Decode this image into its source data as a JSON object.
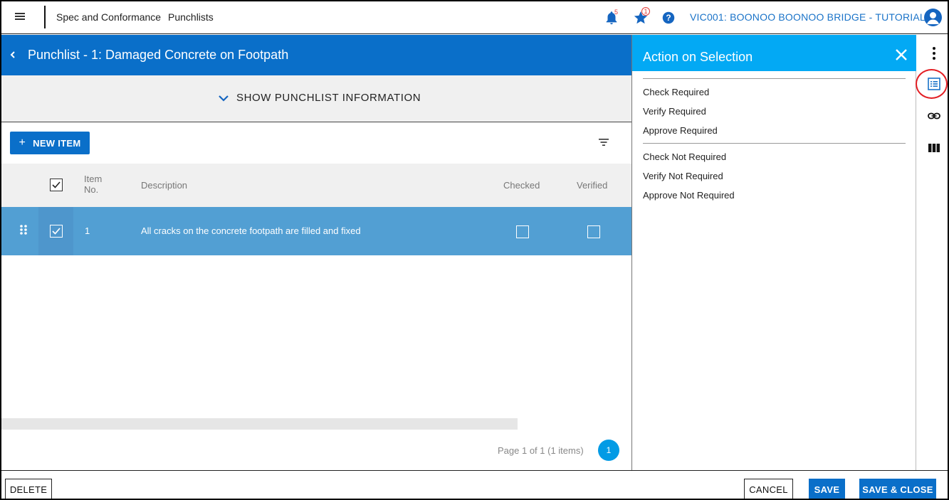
{
  "topbar": {
    "menu_icon": "hamburger-icon",
    "breadcrumb_module": "Spec and Conformance",
    "breadcrumb_page": "Punchlists",
    "notifications_count": "5",
    "favorites_count": "1",
    "project_name": "VIC001: BOONOO BOONOO BRIDGE - TUTORIAL"
  },
  "header": {
    "title": "Punchlist - 1: Damaged Concrete on Footpath"
  },
  "info_band": {
    "toggle_label": "SHOW PUNCHLIST INFORMATION"
  },
  "toolbar": {
    "new_item_label": "NEW ITEM"
  },
  "table": {
    "columns": {
      "item_no_line1": "Item",
      "item_no_line2": "No.",
      "description": "Description",
      "checked": "Checked",
      "verified": "Verified"
    },
    "rows": [
      {
        "item_no": "1",
        "description": "All cracks on the concrete footpath are filled and fixed",
        "selected": true,
        "checked": false,
        "verified": false
      }
    ]
  },
  "pagination": {
    "info": "Page 1 of 1 (1 items)",
    "current_page": "1"
  },
  "action_panel": {
    "title": "Action on Selection",
    "group1": [
      "Check Required",
      "Verify Required",
      "Approve Required"
    ],
    "group2": [
      "Check Not Required",
      "Verify Not Required",
      "Approve Not Required"
    ]
  },
  "footer": {
    "delete_label": "DELETE",
    "cancel_label": "CANCEL",
    "save_label": "SAVE",
    "save_close_label": "SAVE & CLOSE"
  },
  "colors": {
    "primary_blue": "#0a6fc9",
    "panel_blue": "#03a9f4",
    "selected_row": "#529fd3",
    "highlight_ring": "#e31e24"
  }
}
